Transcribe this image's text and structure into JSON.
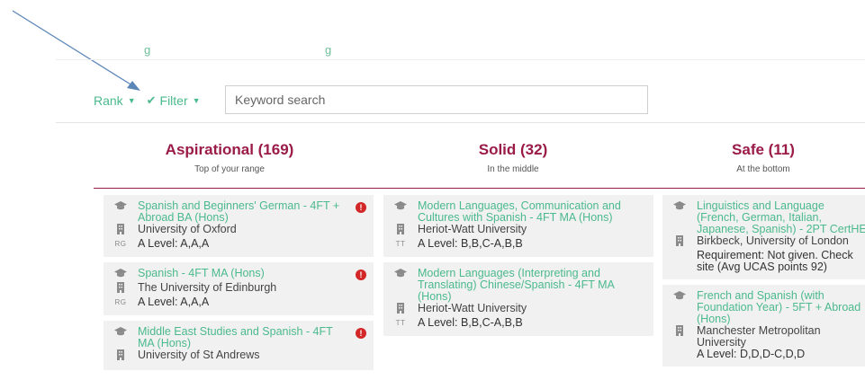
{
  "annotation": {
    "color": "#5b86b8"
  },
  "top_fragment": {
    "text": "g"
  },
  "toolbar": {
    "rank_label": "Rank",
    "filter_label": "Filter",
    "search_placeholder": "Keyword search"
  },
  "colors": {
    "accent": "#4bb98e",
    "brand": "#9b1b48",
    "alert": "#d32626",
    "card_bg": "#f1f1f1"
  },
  "columns": [
    {
      "title": "Aspirational (169)",
      "subtitle": "Top of your range",
      "cards": [
        {
          "course": "Spanish and Beginners' German - 4FT + Abroad BA (Hons)",
          "university": "University of Oxford",
          "tariff_badge": "RG",
          "requirement": "A Level: A,A,A",
          "alert": true
        },
        {
          "course": "Spanish - 4FT MA (Hons)",
          "university": "The University of Edinburgh",
          "tariff_badge": "RG",
          "requirement": "A Level: A,A,A",
          "alert": true
        },
        {
          "course": "Middle East Studies and Spanish - 4FT MA (Hons)",
          "university": "University of St Andrews",
          "tariff_badge": "",
          "requirement": "",
          "alert": true
        }
      ]
    },
    {
      "title": "Solid (32)",
      "subtitle": "In the middle",
      "cards": [
        {
          "course": "Modern Languages, Communication and Cultures with Spanish - 4FT MA (Hons)",
          "university": "Heriot-Watt University",
          "tariff_badge": "TT",
          "requirement": "A Level: B,B,C-A,B,B",
          "alert": false
        },
        {
          "course": "Modern Languages (Interpreting and Translating) Chinese/Spanish - 4FT MA (Hons)",
          "university": "Heriot-Watt University",
          "tariff_badge": "TT",
          "requirement": "A Level: B,B,C-A,B,B",
          "alert": false
        }
      ]
    },
    {
      "title": "Safe (11)",
      "subtitle": "At the bottom",
      "cards": [
        {
          "course": "Linguistics and Language (French, German, Italian, Japanese, Spanish) - 2PT CertHE",
          "university": "Birkbeck, University of London",
          "tariff_badge": "",
          "requirement": "Requirement: Not given. Check site (Avg UCAS points 92)",
          "alert": false
        },
        {
          "course": "French and Spanish (with Foundation Year) - 5FT + Abroad (Hons)",
          "university": "Manchester Metropolitan University",
          "tariff_badge": "",
          "requirement": "A Level: D,D,D-C,D,D",
          "alert": false
        }
      ]
    }
  ]
}
